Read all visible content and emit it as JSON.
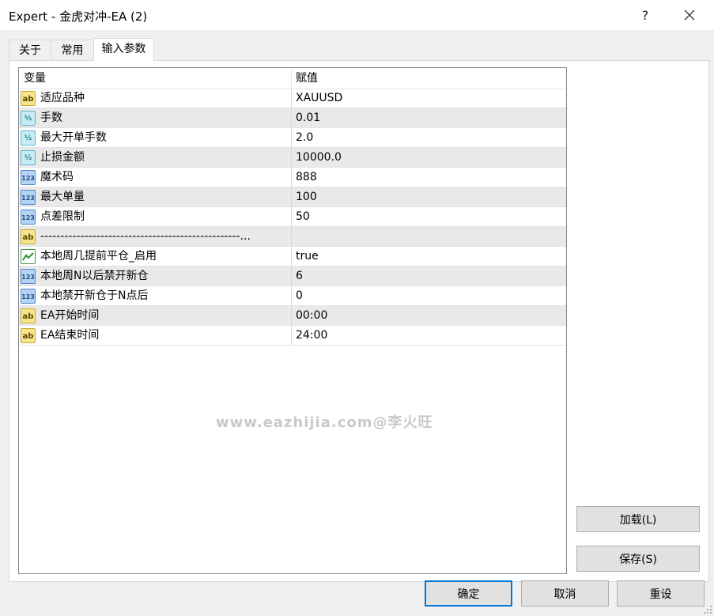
{
  "window": {
    "title": "Expert - 金虎对冲-EA (2)",
    "help": "?"
  },
  "tabs": [
    {
      "label": "关于"
    },
    {
      "label": "常用"
    },
    {
      "label": "输入参数"
    }
  ],
  "grid": {
    "headers": {
      "variable": "变量",
      "value": "赋值"
    },
    "rows": [
      {
        "icon": "ab-string-icon",
        "name": "适应品种",
        "value": "XAUUSD"
      },
      {
        "icon": "half-double-icon",
        "name": "手数",
        "value": "0.01"
      },
      {
        "icon": "half-double-icon",
        "name": "最大开单手数",
        "value": "2.0"
      },
      {
        "icon": "half-double-icon",
        "name": "止损金额",
        "value": "10000.0"
      },
      {
        "icon": "123-integer-icon",
        "name": "魔术码",
        "value": "888"
      },
      {
        "icon": "123-integer-icon",
        "name": "最大单量",
        "value": "100"
      },
      {
        "icon": "123-integer-icon",
        "name": "点差限制",
        "value": "50"
      },
      {
        "icon": "ab-string-icon",
        "name": "--------------------------------------------------...",
        "value": ""
      },
      {
        "icon": "bool-icon",
        "name": "本地周几提前平仓_启用",
        "value": "true"
      },
      {
        "icon": "123-integer-icon",
        "name": "本地周N以后禁开新仓",
        "value": "6"
      },
      {
        "icon": "123-integer-icon",
        "name": "本地禁开新仓于N点后",
        "value": "0"
      },
      {
        "icon": "ab-string-icon",
        "name": "EA开始时间",
        "value": "00:00"
      },
      {
        "icon": "ab-string-icon",
        "name": "EA结束时间",
        "value": "24:00"
      }
    ]
  },
  "watermark": "www.eazhijia.com@李火旺",
  "side_buttons": {
    "load": "加载(L)",
    "save": "保存(S)"
  },
  "footer_buttons": {
    "ok": "确定",
    "cancel": "取消",
    "reset": "重设"
  },
  "colors": {
    "accent": "#0078d7",
    "alt_row": "#e9e9e9"
  }
}
